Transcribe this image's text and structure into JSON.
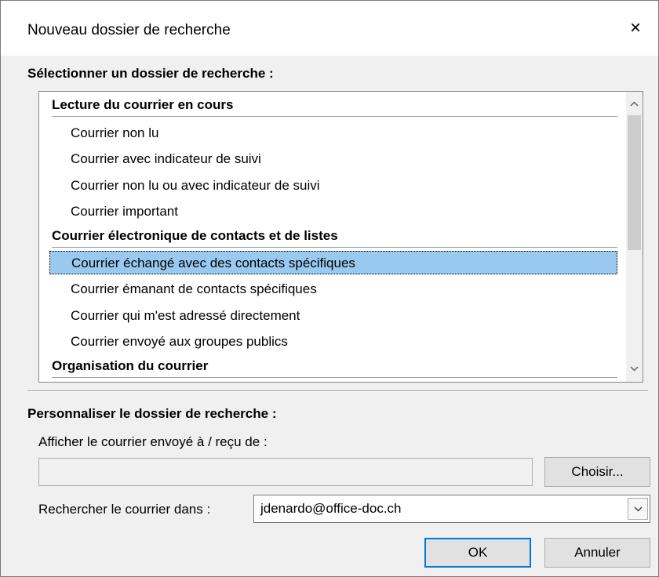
{
  "dialog": {
    "title": "Nouveau dossier de recherche",
    "close_icon": "×"
  },
  "select_section": {
    "label": "Sélectionner un dossier de recherche :",
    "groups": [
      {
        "header": "Lecture du courrier en cours",
        "items": [
          "Courrier non lu",
          "Courrier avec indicateur de suivi",
          "Courrier non lu ou avec indicateur de suivi",
          "Courrier important"
        ]
      },
      {
        "header": "Courrier électronique de contacts et de listes",
        "items": [
          "Courrier échangé avec des contacts spécifiques",
          "Courrier émanant de contacts spécifiques",
          "Courrier qui m'est adressé directement",
          "Courrier envoyé aux groupes publics"
        ]
      },
      {
        "header": "Organisation du courrier",
        "items": []
      }
    ],
    "selected_item": "Courrier échangé avec des contacts spécifiques",
    "scroll_up_icon": "chevron-up-icon",
    "scroll_down_icon": "chevron-down-icon"
  },
  "customize_section": {
    "label": "Personnaliser le dossier de recherche :",
    "show_mail_label": "Afficher le courrier envoyé à / reçu de :",
    "show_mail_value": "",
    "choose_button": "Choisir...",
    "search_in_label": "Rechercher le courrier dans :",
    "search_in_value": "jdenardo@office-doc.ch"
  },
  "footer": {
    "ok_button": "OK",
    "cancel_button": "Annuler"
  }
}
